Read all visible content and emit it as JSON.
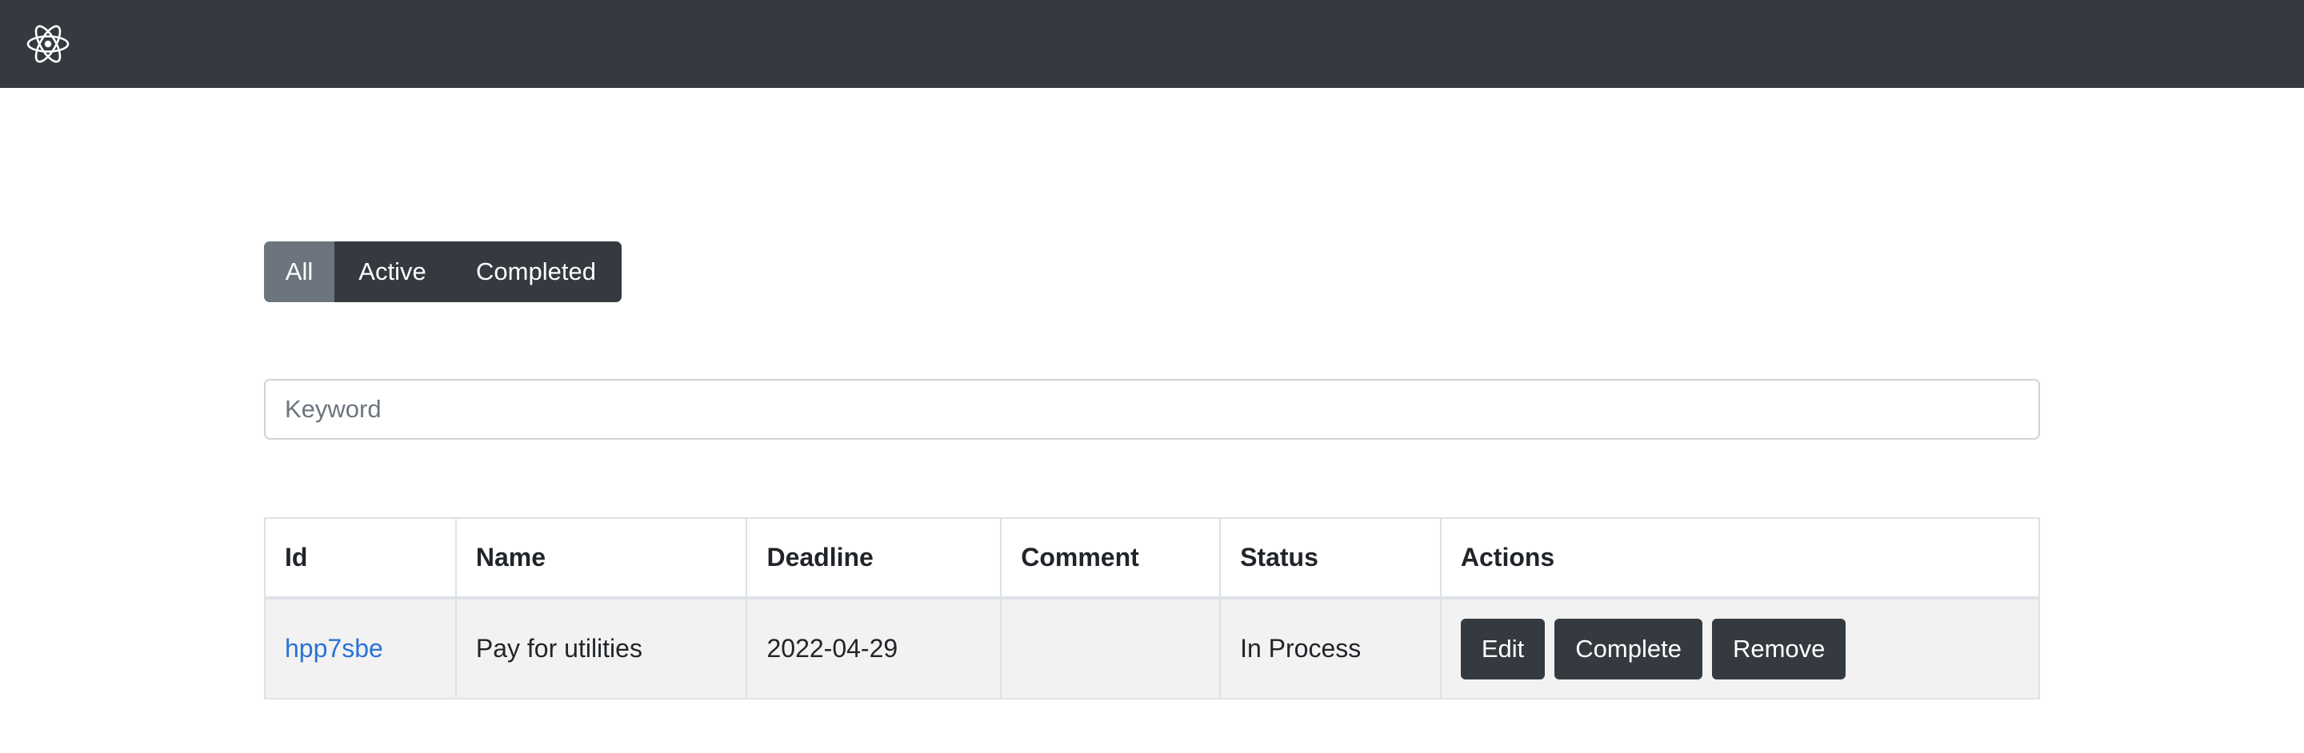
{
  "navbar": {
    "logo_icon": "react-atom-icon",
    "bg_color": "#343a40"
  },
  "filters": {
    "items": [
      {
        "label": "All",
        "active": true
      },
      {
        "label": "Active",
        "active": false
      },
      {
        "label": "Completed",
        "active": false
      }
    ]
  },
  "search": {
    "placeholder": "Keyword",
    "value": ""
  },
  "table": {
    "columns": [
      "Id",
      "Name",
      "Deadline",
      "Comment",
      "Status",
      "Actions"
    ],
    "rows": [
      {
        "id": "hpp7sbe",
        "name": "Pay for utilities",
        "deadline": "2022-04-29",
        "comment": "",
        "status": "In Process",
        "actions": [
          "Edit",
          "Complete",
          "Remove"
        ]
      }
    ]
  },
  "colors": {
    "primary_dark": "#343a40",
    "active_filter": "#6c757d",
    "link": "#2a73d6"
  }
}
